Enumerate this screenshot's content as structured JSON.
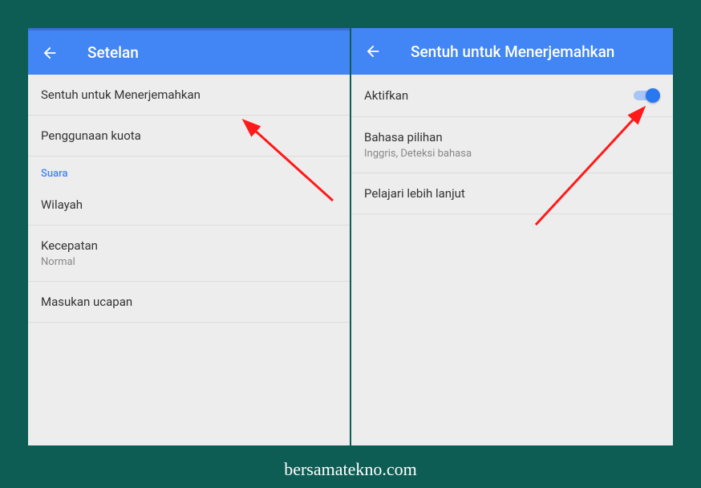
{
  "left": {
    "title": "Setelan",
    "items": {
      "tap_translate": "Sentuh untuk Menerjemahkan",
      "data_usage": "Penggunaan kuota",
      "section_sound": "Suara",
      "region": "Wilayah",
      "speed_label": "Kecepatan",
      "speed_value": "Normal",
      "speech_input": "Masukan ucapan"
    }
  },
  "right": {
    "title": "Sentuh untuk Menerjemahkan",
    "enable_label": "Aktifkan",
    "pref_lang_label": "Bahasa pilihan",
    "pref_lang_value": "Inggris, Deteksi bahasa",
    "learn_more": "Pelajari lebih lanjut"
  },
  "watermark": "bersamatekno.com"
}
